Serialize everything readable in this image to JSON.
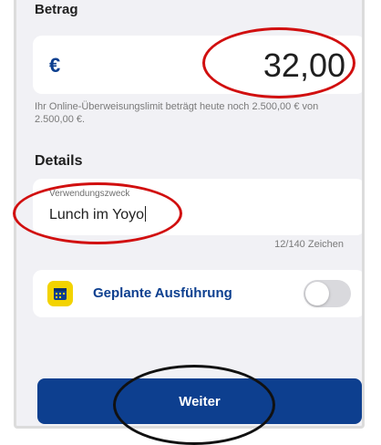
{
  "amount_section": {
    "title": "Betrag",
    "currency_symbol": "€",
    "amount": "32,00",
    "limit_note": "Ihr Online-Überweisungslimit beträgt heute noch 2.500,00 € von 2.500,00 €."
  },
  "details_section": {
    "title": "Details",
    "purpose_label": "Verwendungszweck",
    "purpose_value": "Lunch im Yoyo",
    "char_counter": "12/140 Zeichen"
  },
  "scheduled": {
    "label": "Geplante Ausführung",
    "icon": "calendar-icon",
    "toggle_on": false
  },
  "next_button": {
    "label": "Weiter"
  },
  "colors": {
    "brand_blue": "#0d3f8f",
    "accent_yellow": "#f3d300",
    "annotation_red": "#d10f0f"
  }
}
